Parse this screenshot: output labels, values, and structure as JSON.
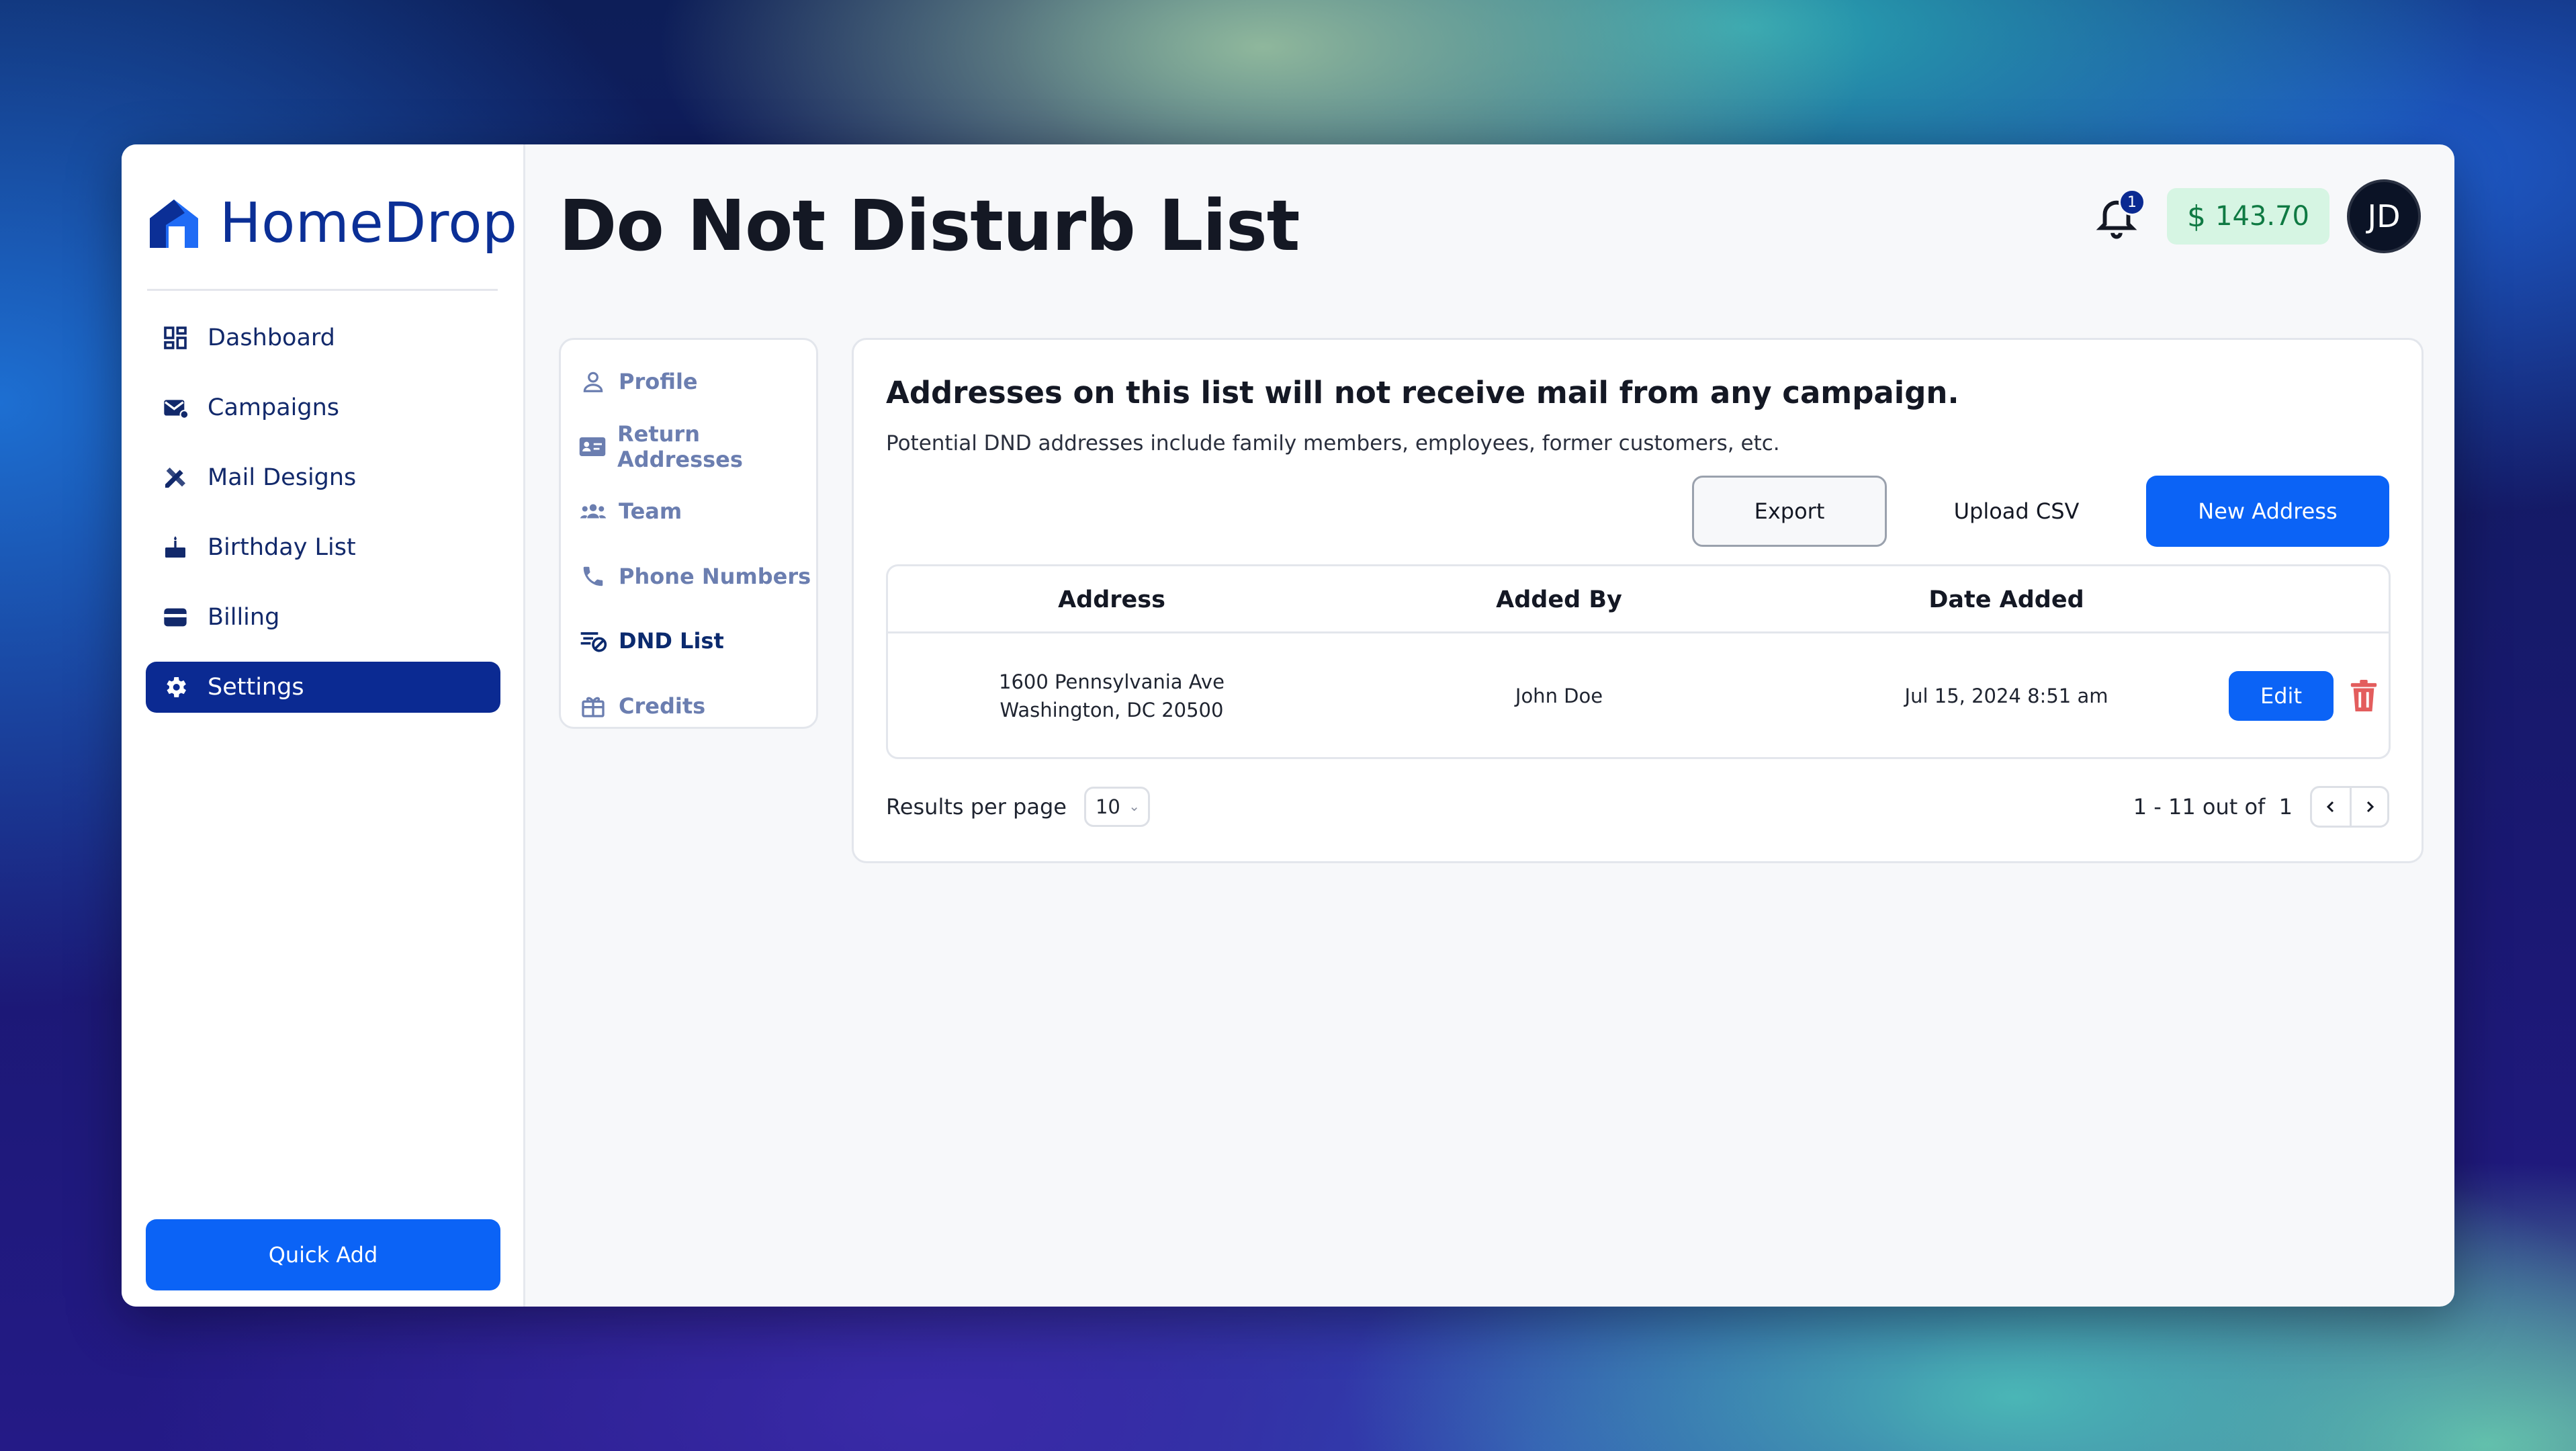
{
  "app": {
    "brand": "HomeDrop",
    "accent": "#0b63f6",
    "nav_active_bg": "#0b2a92"
  },
  "sidebar": {
    "items": [
      {
        "label": "Dashboard",
        "icon": "dashboard-icon"
      },
      {
        "label": "Campaigns",
        "icon": "mail-icon"
      },
      {
        "label": "Mail Designs",
        "icon": "design-tools-icon"
      },
      {
        "label": "Birthday List",
        "icon": "cake-icon"
      },
      {
        "label": "Billing",
        "icon": "card-icon"
      },
      {
        "label": "Settings",
        "icon": "gear-icon",
        "active": true
      }
    ],
    "quick_add": "Quick Add"
  },
  "header": {
    "title": "Do Not Disturb List",
    "notifications_count": "1",
    "balance_currency": "$",
    "balance": "143.70",
    "avatar_initials": "JD"
  },
  "settings_menu": {
    "items": [
      {
        "label": "Profile",
        "icon": "user-icon"
      },
      {
        "label": "Return Addresses",
        "icon": "id-card-icon"
      },
      {
        "label": "Team",
        "icon": "users-icon"
      },
      {
        "label": "Phone Numbers",
        "icon": "phone-icon"
      },
      {
        "label": "DND List",
        "icon": "mail-blocked-icon",
        "active": true
      },
      {
        "label": "Credits",
        "icon": "gift-icon"
      }
    ]
  },
  "dnd": {
    "heading": "Addresses on this list will not receive mail from any campaign.",
    "subheading": "Potential DND addresses include family members, employees, former customers, etc.",
    "export_label": "Export",
    "upload_label": "Upload CSV",
    "new_label": "New Address",
    "columns": [
      "Address",
      "Added By",
      "Date Added"
    ],
    "rows": [
      {
        "address_line1": "1600 Pennsylvania Ave",
        "address_line2": "Washington, DC 20500",
        "added_by": "John Doe",
        "date_added": "Jul 15, 2024 8:51 am",
        "edit_label": "Edit"
      }
    ],
    "results_per_page_label": "Results per page",
    "results_per_page_value": "10",
    "pagination": "1 - 11 out of  1"
  }
}
